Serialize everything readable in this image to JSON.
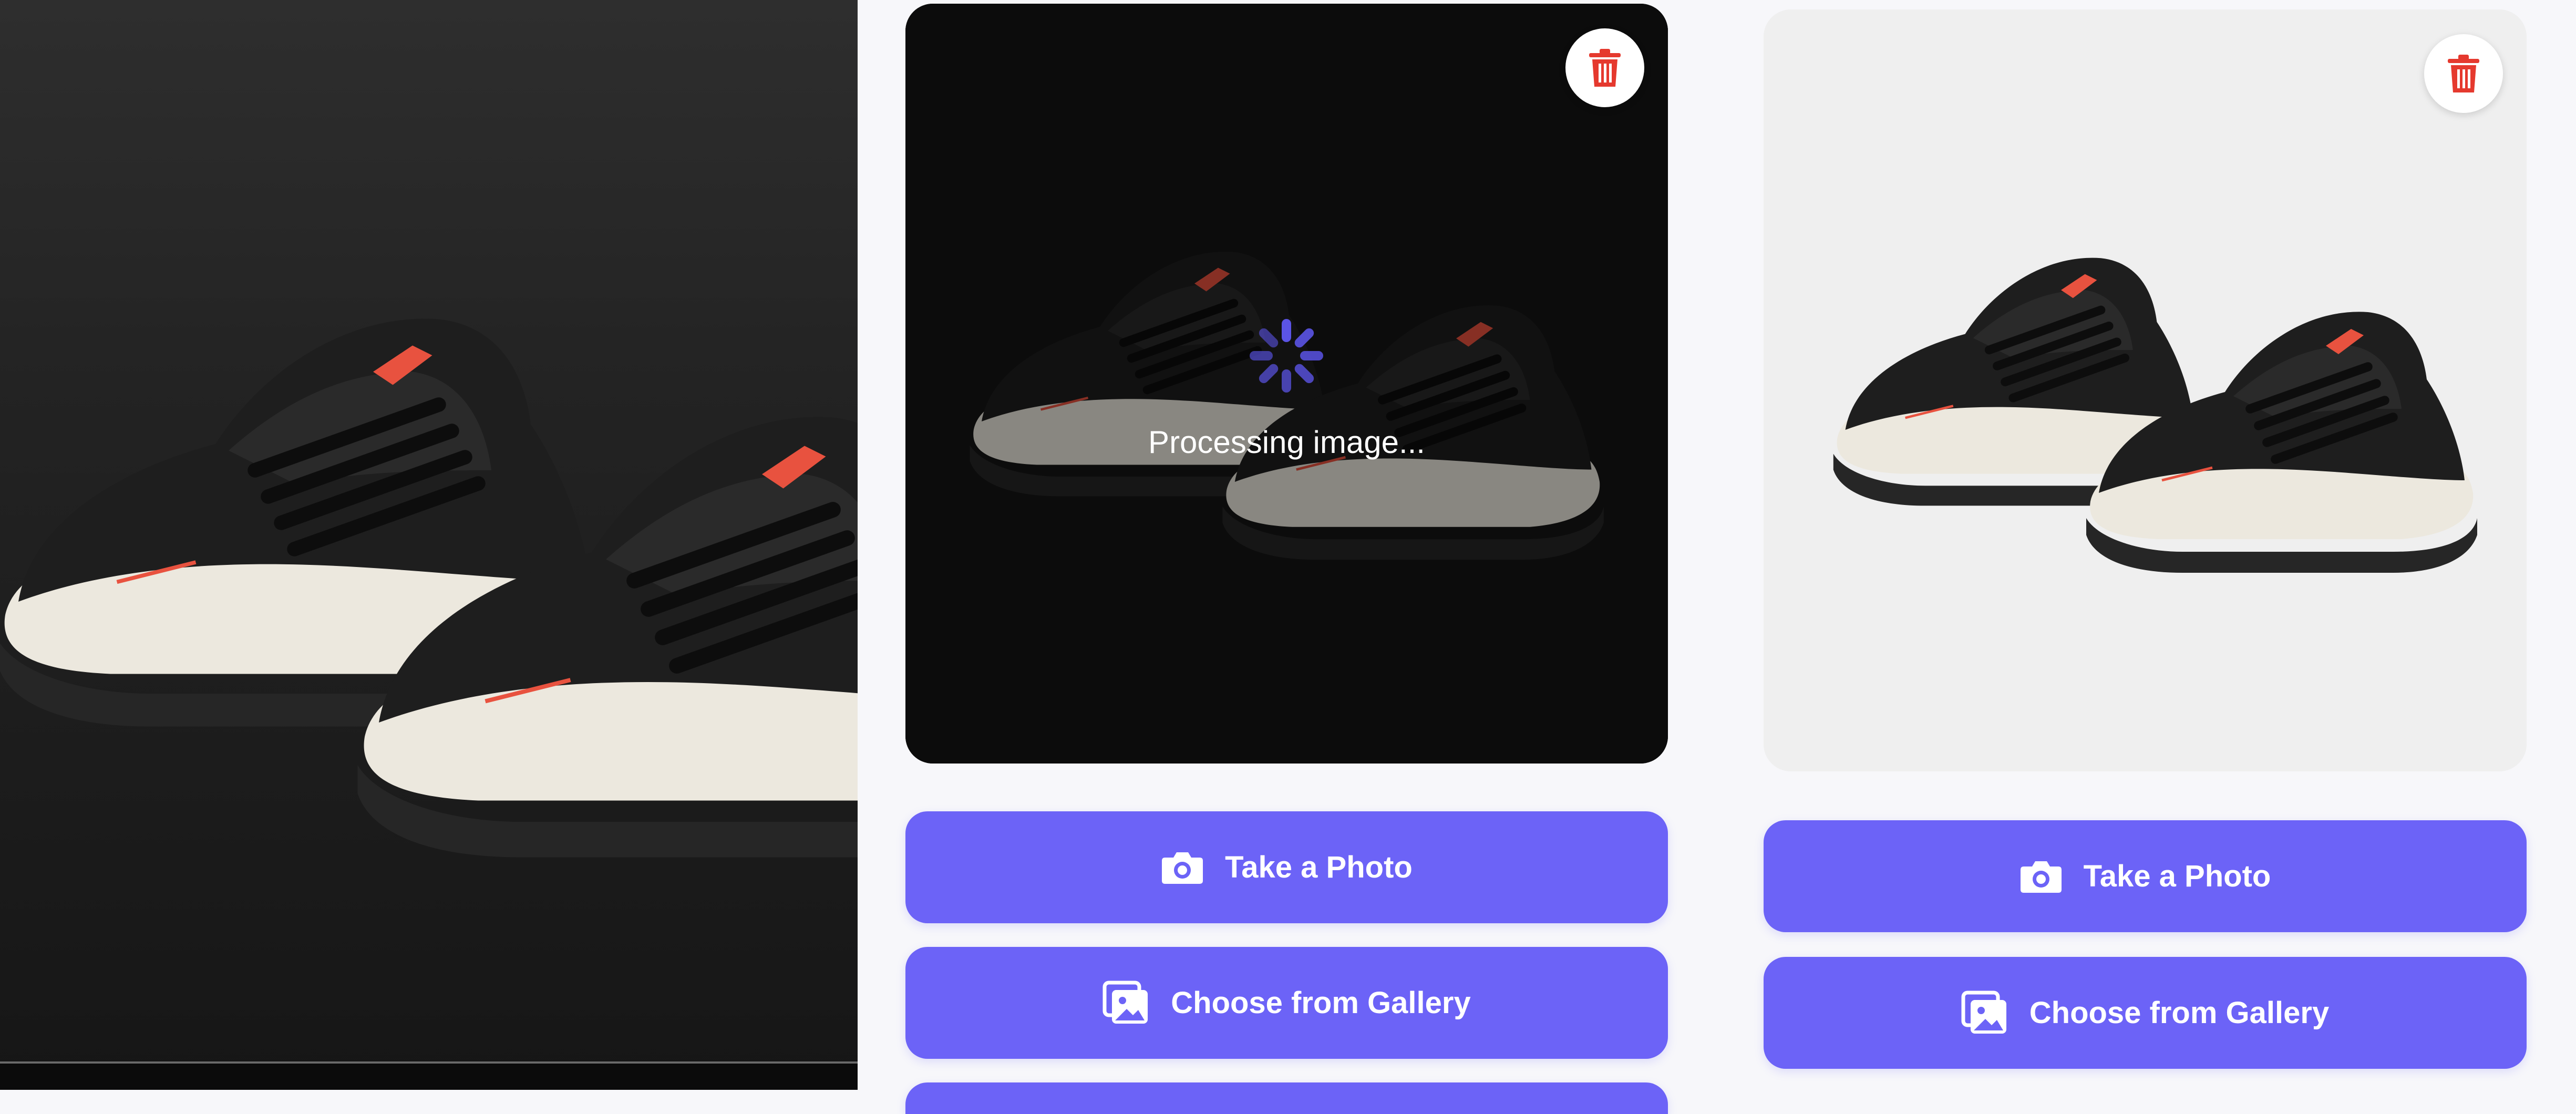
{
  "left_panel": {
    "image": "sneakers-original-photo"
  },
  "middle_panel": {
    "image": "sneakers-processing-photo",
    "delete_icon": "trash-icon",
    "spinner_icon": "loading-spinner-icon",
    "status_text": "Processing image...",
    "buttons": {
      "take_photo": "Take a Photo",
      "choose_gallery": "Choose from Gallery"
    }
  },
  "right_panel": {
    "image": "sneakers-background-removed-photo",
    "delete_icon": "trash-icon",
    "buttons": {
      "take_photo": "Take a Photo",
      "choose_gallery": "Choose from Gallery"
    }
  },
  "colors": {
    "accent": "#6c63f7",
    "delete": "#e5392e",
    "spinner": "#5b54e6",
    "sneaker_body": "#1e1e1e",
    "sneaker_sole": "#ece8de",
    "sneaker_accent": "#e8523f"
  }
}
